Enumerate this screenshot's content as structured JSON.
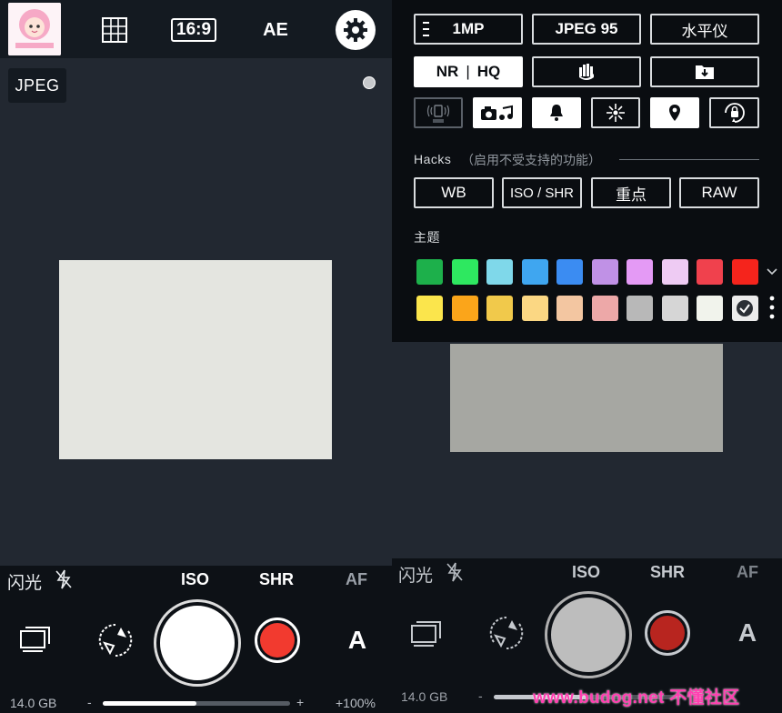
{
  "left": {
    "top_bar": {
      "ratio_label": "16:9",
      "ae_label": "AE"
    },
    "format_tag": "JPEG",
    "modes": {
      "flash_label": "闪光",
      "iso_label": "ISO",
      "shr_label": "SHR",
      "af_label": "AF"
    },
    "auto_label": "A",
    "storage": "14.0 GB",
    "zoom_minus": "-",
    "zoom_plus": "+",
    "zoom_value": "+100%",
    "zoom_level": 0.5
  },
  "right": {
    "settings": {
      "row1": [
        "1MP",
        "JPEG 95",
        "水平仪"
      ],
      "row2_nr": "NR",
      "row2_hq": "HQ",
      "hacks_label": "Hacks",
      "hacks_sub": "（启用不受支持的功能）",
      "hacks_buttons": [
        "WB",
        "ISO / SHR",
        "重点",
        "RAW"
      ],
      "theme_label": "主题",
      "theme_colors_row1": [
        "#1db04b",
        "#2ee860",
        "#7fd8ea",
        "#3fa6f0",
        "#3b8cf2",
        "#c091e6",
        "#e49af5",
        "#eecbf3",
        "#f0414d",
        "#f5241c"
      ],
      "theme_colors_row2": [
        "#fbe54c",
        "#fba51a",
        "#f1c94b",
        "#fbd783",
        "#f3c6a1",
        "#eda8a8",
        "#b8b8b8",
        "#d6d6d6",
        "#f1f3ec",
        "#ffffff"
      ],
      "selected_theme_index": 19
    },
    "modes": {
      "flash_label": "闪光",
      "iso_label": "ISO",
      "shr_label": "SHR",
      "af_label": "AF"
    },
    "auto_label": "A",
    "storage": "14.0 GB",
    "zoom_minus": "-",
    "zoom_level": 0.5
  },
  "watermark": "www.budog.net 不懂社区"
}
